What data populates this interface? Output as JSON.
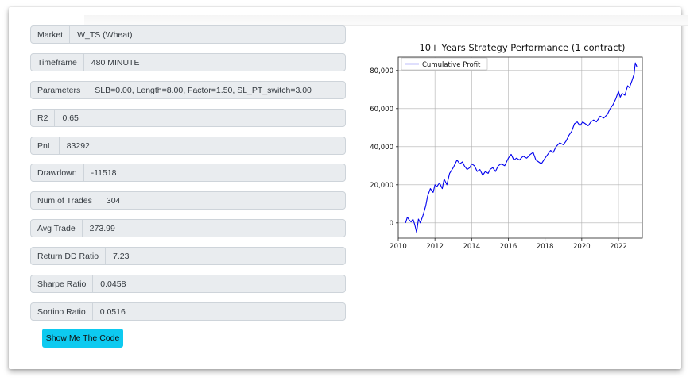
{
  "fields": [
    {
      "label": "Market",
      "value": "W_TS (Wheat)"
    },
    {
      "label": "Timeframe",
      "value": "480 MINUTE"
    },
    {
      "label": "Parameters",
      "value": "SLB=0.00, Length=8.00, Factor=1.50, SL_PT_switch=3.00"
    },
    {
      "label": "R2",
      "value": "0.65"
    },
    {
      "label": "PnL",
      "value": "83292"
    },
    {
      "label": "Drawdown",
      "value": "-11518"
    },
    {
      "label": "Num of Trades",
      "value": "304"
    },
    {
      "label": "Avg Trade",
      "value": "273.99"
    },
    {
      "label": "Return DD Ratio",
      "value": "7.23"
    },
    {
      "label": "Sharpe Ratio",
      "value": "0.0458"
    },
    {
      "label": "Sortino Ratio",
      "value": "0.0516"
    }
  ],
  "button": {
    "label": "Show Me The Code"
  },
  "colors": {
    "accent": "#0dcaf0",
    "series": "#0000ee"
  },
  "chart_data": {
    "type": "line",
    "title": "10+ Years Strategy Performance (1 contract)",
    "xlabel": "",
    "ylabel": "",
    "xlim": [
      2010,
      2023.3
    ],
    "ylim": [
      -8000,
      87000
    ],
    "x_ticks": [
      2010,
      2012,
      2014,
      2016,
      2018,
      2020,
      2022
    ],
    "y_ticks": [
      0,
      20000,
      40000,
      60000,
      80000
    ],
    "y_tick_labels": [
      "0",
      "20,000",
      "40,000",
      "60,000",
      "80,000"
    ],
    "grid": true,
    "legend_position": "top-left",
    "series": [
      {
        "name": "Cumulative Profit",
        "x": [
          2010.4,
          2010.5,
          2010.6,
          2010.7,
          2010.8,
          2010.9,
          2011.0,
          2011.1,
          2011.2,
          2011.35,
          2011.5,
          2011.6,
          2011.75,
          2011.9,
          2012.0,
          2012.1,
          2012.25,
          2012.4,
          2012.5,
          2012.65,
          2012.8,
          2013.0,
          2013.2,
          2013.35,
          2013.5,
          2013.6,
          2013.75,
          2013.9,
          2014.0,
          2014.15,
          2014.3,
          2014.45,
          2014.6,
          2014.75,
          2014.9,
          2015.0,
          2015.15,
          2015.3,
          2015.45,
          2015.6,
          2015.8,
          2016.0,
          2016.15,
          2016.3,
          2016.45,
          2016.6,
          2016.8,
          2017.0,
          2017.2,
          2017.35,
          2017.5,
          2017.65,
          2017.8,
          2018.0,
          2018.15,
          2018.3,
          2018.45,
          2018.6,
          2018.8,
          2019.0,
          2019.15,
          2019.3,
          2019.45,
          2019.6,
          2019.75,
          2019.9,
          2020.05,
          2020.2,
          2020.35,
          2020.5,
          2020.65,
          2020.8,
          2021.0,
          2021.2,
          2021.4,
          2021.55,
          2021.7,
          2021.85,
          2022.0,
          2022.1,
          2022.2,
          2022.35,
          2022.5,
          2022.6,
          2022.75,
          2022.85,
          2022.92,
          2023.0
        ],
        "values": [
          0,
          3000,
          1500,
          500,
          2000,
          -1000,
          -5000,
          2000,
          0,
          4000,
          9000,
          14000,
          18000,
          16000,
          20000,
          19000,
          21000,
          18000,
          23000,
          20000,
          26000,
          29000,
          33000,
          31000,
          32000,
          30000,
          28000,
          29000,
          31000,
          30000,
          27000,
          28000,
          25000,
          27000,
          26000,
          28000,
          29000,
          27000,
          30000,
          31000,
          30000,
          34000,
          36000,
          33000,
          34000,
          33000,
          35000,
          34000,
          36000,
          37000,
          33000,
          32000,
          31000,
          34000,
          36000,
          38000,
          37000,
          40000,
          42000,
          41000,
          43000,
          46000,
          48000,
          52000,
          53000,
          51000,
          53000,
          52000,
          51000,
          53000,
          54000,
          53000,
          56000,
          55000,
          57000,
          60000,
          62000,
          65000,
          69000,
          66000,
          68000,
          67000,
          72000,
          71000,
          75000,
          78000,
          84000,
          82000
        ]
      }
    ]
  }
}
